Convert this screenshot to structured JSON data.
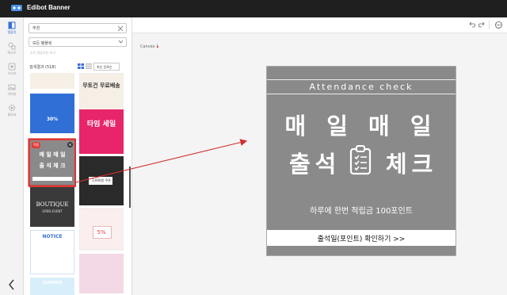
{
  "app": {
    "title": "Edibot Banner"
  },
  "colors": {
    "accent": "#3b6fd8",
    "annotation": "#d32f2f",
    "banner_bg": "#8a8a8a"
  },
  "rail": {
    "items": [
      {
        "label": "템플릿",
        "icon": "template-icon"
      },
      {
        "label": "텍스트",
        "icon": "text-icon"
      },
      {
        "label": "스티커",
        "icon": "sticker-icon"
      },
      {
        "label": "이미지",
        "icon": "image-icon"
      },
      {
        "label": "좋아요",
        "icon": "settings-icon"
      }
    ]
  },
  "panel": {
    "search_value": "추천",
    "category_select": "모든 템플릿",
    "filter_hint": "추천 템플릿만 보기",
    "result_count": "검색결과 (518)",
    "sort": "최신 등록순",
    "templates": [
      {
        "text": "무토건 무료배송"
      },
      {
        "text": "30%"
      },
      {
        "text": "타임 세일"
      },
      {
        "badge": "적용",
        "text1": "매 일 매 일",
        "text2": "출 석 체 크"
      },
      {
        "text": "3,000원 쿠폰"
      },
      {
        "text1": "BOUTIQUE",
        "text2": "OPEN EVENT"
      },
      {
        "text": "5%"
      },
      {
        "text": "NOTICE"
      },
      {
        "text": "SUMMER"
      }
    ]
  },
  "toolbar": {
    "undo": "undo-icon",
    "redo": "redo-icon",
    "more": "more-icon"
  },
  "canvas": {
    "label": "Canvas 1"
  },
  "banner": {
    "subtitle": "Attendance check",
    "title_line1": "매 일 매 일",
    "title_line2a": "출석",
    "title_line2b": "체크",
    "description": "하루에 한번 적립금 100포인트",
    "button": "출석일(포인트) 확인하기 >>"
  }
}
